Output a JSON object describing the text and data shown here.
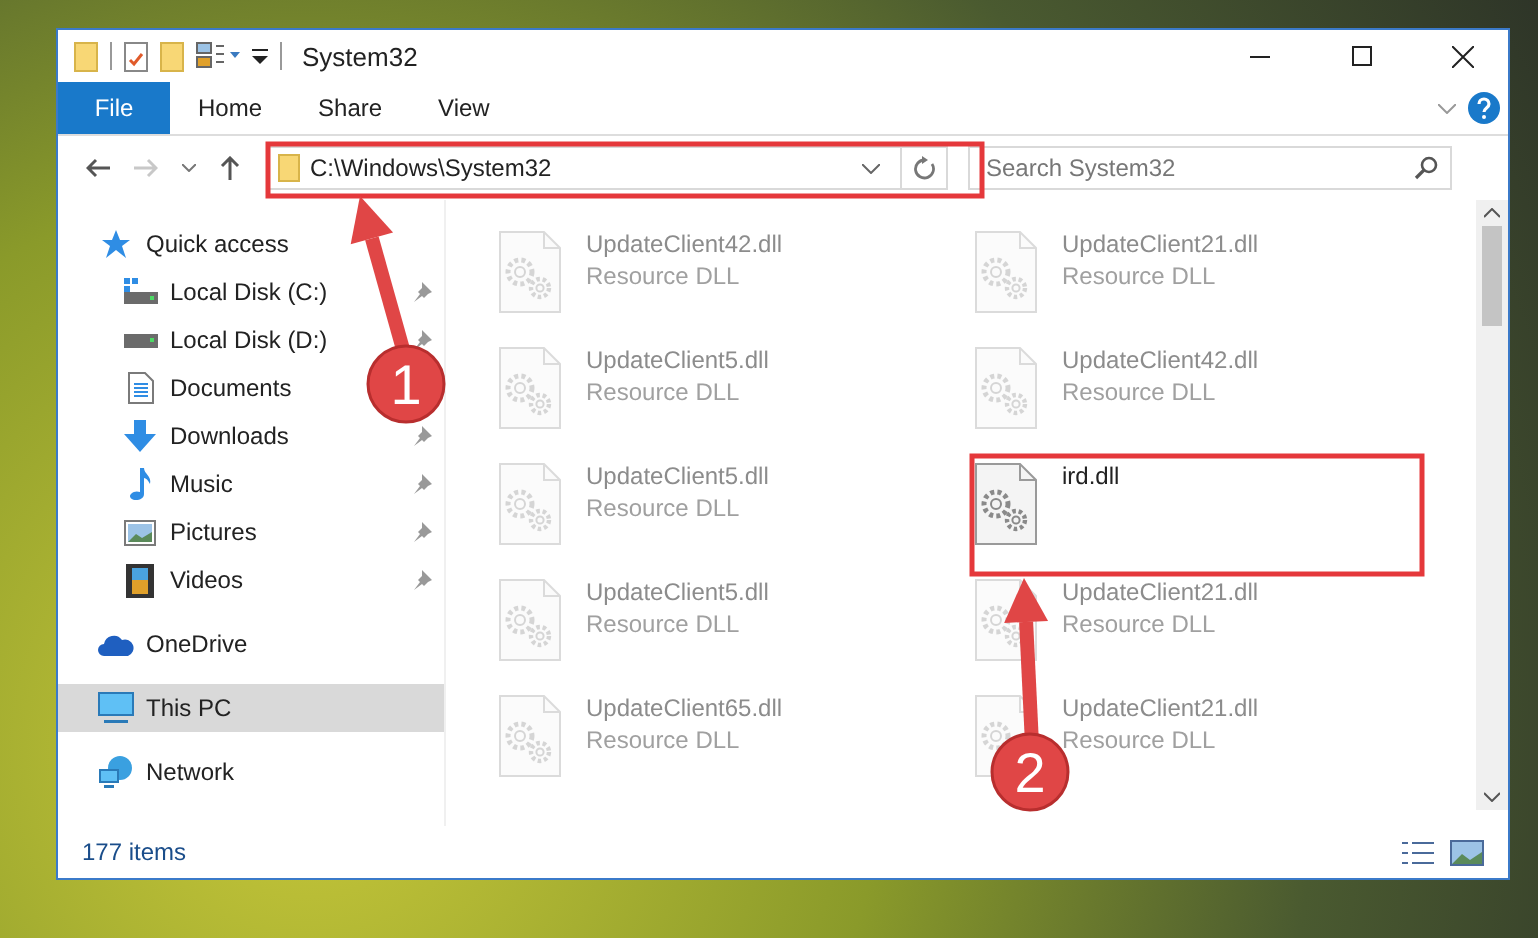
{
  "window": {
    "title": "System32"
  },
  "ribbon": {
    "tabs": [
      {
        "label": "File",
        "kind": "file",
        "selected": false
      },
      {
        "label": "Home",
        "kind": "plain",
        "selected": false
      },
      {
        "label": "Share",
        "kind": "plain",
        "selected": false
      },
      {
        "label": "View",
        "kind": "plain",
        "selected": false
      }
    ]
  },
  "address_bar": {
    "path": "C:\\Windows\\System32"
  },
  "search": {
    "placeholder": "Search System32"
  },
  "nav": {
    "items": [
      {
        "label": "Quick access",
        "kind": "star",
        "selected": false,
        "children": [
          {
            "label": "Local Disk (C:)",
            "kind": "system-drive",
            "pinned": true,
            "selected": false
          },
          {
            "label": "Local Disk (D:)",
            "kind": "drive",
            "pinned": true,
            "selected": false
          },
          {
            "label": "Documents",
            "kind": "documents",
            "pinned": false,
            "selected": false
          },
          {
            "label": "Downloads",
            "kind": "downloads",
            "pinned": true,
            "selected": false
          },
          {
            "label": "Music",
            "kind": "music",
            "pinned": true,
            "selected": false
          },
          {
            "label": "Pictures",
            "kind": "pictures",
            "pinned": true,
            "selected": false
          },
          {
            "label": "Videos",
            "kind": "videos",
            "pinned": true,
            "selected": false
          }
        ]
      },
      {
        "label": "OneDrive",
        "kind": "cloud",
        "selected": false
      },
      {
        "label": "This PC",
        "kind": "computer",
        "selected": true
      },
      {
        "label": "Network",
        "kind": "network",
        "selected": false
      }
    ]
  },
  "files": [
    {
      "name": "UpdateClient42.dll",
      "type": "Resource DLL",
      "blurred": true
    },
    {
      "name": "UpdateClient21.dll",
      "type": "Resource DLL",
      "blurred": true
    },
    {
      "name": "UpdateClient5.dll",
      "type": "Resource DLL",
      "blurred": true
    },
    {
      "name": "UpdateClient42.dll",
      "type": "Resource DLL",
      "blurred": true
    },
    {
      "name": "UpdateClient5.dll",
      "type": "Resource DLL",
      "blurred": true
    },
    {
      "name": "ird.dll",
      "blurred": false
    },
    {
      "name": "UpdateClient5.dll",
      "type": "Resource DLL",
      "blurred": true
    },
    {
      "name": "UpdateClient21.dll",
      "type": "Resource DLL",
      "blurred": true
    },
    {
      "name": "UpdateClient65.dll",
      "type": "Resource DLL",
      "blurred": true
    },
    {
      "name": "UpdateClient21.dll",
      "type": "Resource DLL",
      "blurred": true
    }
  ],
  "status_bar": {
    "count": "177 items"
  },
  "annotations": [
    {
      "label": "1"
    },
    {
      "label": "2"
    }
  ]
}
